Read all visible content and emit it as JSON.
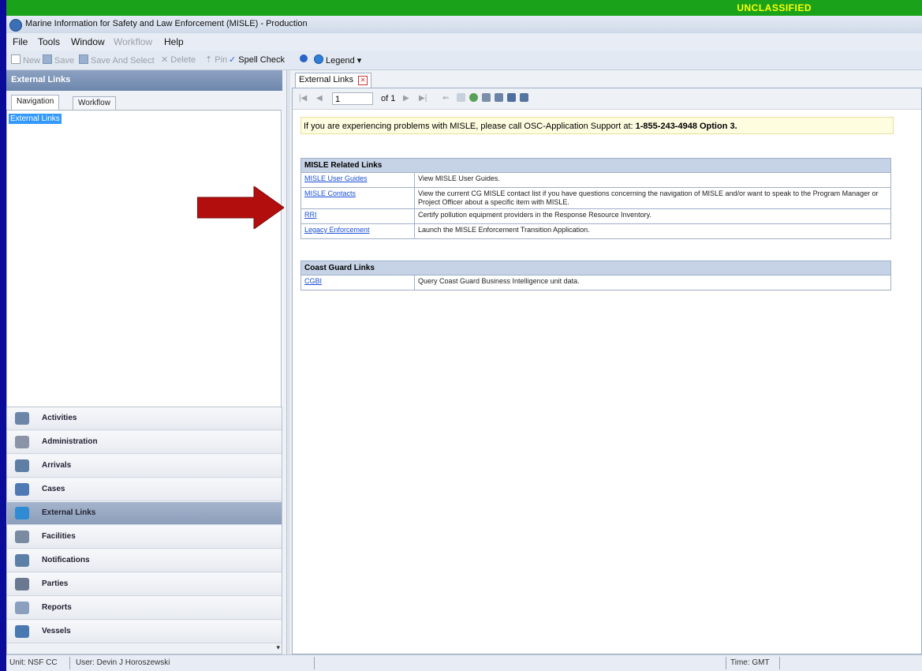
{
  "classification": "UNCLASSIFIED",
  "window": {
    "title": "Marine Information for Safety and Law Enforcement (MISLE) - Production"
  },
  "menu": [
    "File",
    "Tools",
    "Window",
    "Workflow",
    "Help"
  ],
  "toolbar": {
    "new": "New",
    "save": "Save",
    "save_select": "Save And Select",
    "delete": "Delete",
    "pin": "Pin",
    "spell_check": "Spell Check",
    "legend": "Legend"
  },
  "left_panel": {
    "header": "External Links",
    "tabs": [
      "Navigation",
      "Workflow"
    ],
    "tree_selected": "External Links",
    "nav_items": [
      {
        "label": "Activities",
        "icon": "activities-icon",
        "color": "#6d86a8"
      },
      {
        "label": "Administration",
        "icon": "administration-icon",
        "color": "#8a94a6"
      },
      {
        "label": "Arrivals",
        "icon": "arrivals-icon",
        "color": "#5f7ea3"
      },
      {
        "label": "Cases",
        "icon": "cases-icon",
        "color": "#4f79b3"
      },
      {
        "label": "External Links",
        "icon": "external-links-icon",
        "color": "#2e8bd4"
      },
      {
        "label": "Facilities",
        "icon": "facilities-icon",
        "color": "#7a8aa0"
      },
      {
        "label": "Notifications",
        "icon": "notifications-icon",
        "color": "#5c7fa8"
      },
      {
        "label": "Parties",
        "icon": "parties-icon",
        "color": "#6a7890"
      },
      {
        "label": "Reports",
        "icon": "reports-icon",
        "color": "#8aa0be"
      },
      {
        "label": "Vessels",
        "icon": "vessels-icon",
        "color": "#4a78b0"
      }
    ],
    "active_nav": "External Links"
  },
  "document_tab": {
    "label": "External Links"
  },
  "report_toolbar": {
    "page": "1",
    "of_label": "of 1"
  },
  "notice": {
    "text": "If you are experiencing problems with MISLE, please call OSC-Application Support at: ",
    "phone": "1-855-243-4948 Option 3."
  },
  "misle_links": {
    "header": "MISLE Related Links",
    "rows": [
      {
        "link": "MISLE User Guides",
        "desc": "View MISLE User Guides."
      },
      {
        "link": "MISLE Contacts",
        "desc": "View the current CG MISLE contact list if you have questions concerning the navigation of MISLE and/or want to speak to the Program Manager or Project Officer about a specific item with MISLE."
      },
      {
        "link": "RRI",
        "desc": "Certify pollution equipment providers in the Response Resource Inventory."
      },
      {
        "link": "Legacy Enforcement",
        "desc": "Launch the MISLE Enforcement Transition Application."
      }
    ]
  },
  "cg_links": {
    "header": "Coast Guard Links",
    "rows": [
      {
        "link": "CGBI",
        "desc": "Query Coast Guard Business Intelligence unit data."
      }
    ]
  },
  "status": {
    "unit": "Unit: NSF CC",
    "user": "User: Devin J Horoszewski",
    "time": "Time: GMT"
  },
  "colors": {
    "classification_bar": "#1aa31a",
    "background": "#0b0b9a",
    "arrow": "#b30e0e",
    "link": "#1a4fd6"
  }
}
